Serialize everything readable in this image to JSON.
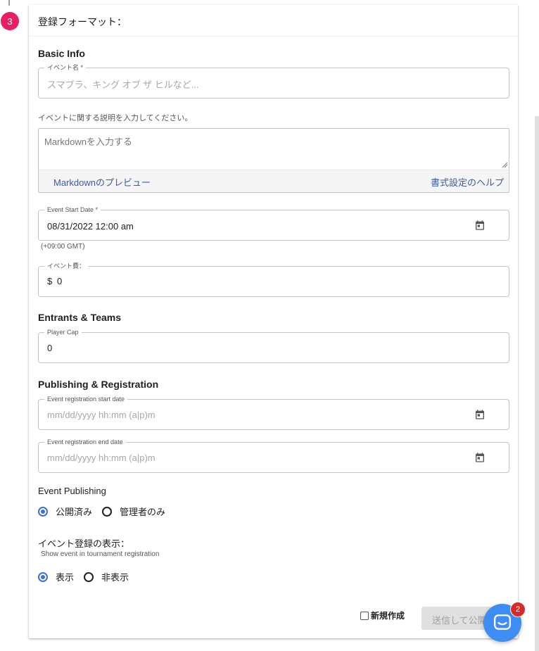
{
  "step": {
    "number": "3"
  },
  "header": {
    "title": "登録フォーマット："
  },
  "basic_info": {
    "title": "Basic Info",
    "event_name": {
      "label": "イベント名 *",
      "placeholder": "スマブラ、キング オブ ザ ヒルなど..."
    },
    "description": {
      "helper": "イベントに関する説明を入力してください。",
      "placeholder": "Markdownを入力する",
      "preview_link": "Markdownのプレビュー",
      "help_link": "書式設定のヘルプ"
    },
    "start_date": {
      "label": "Event Start Date *",
      "value": "08/31/2022 12:00 am",
      "timezone": "(+09:00 GMT)",
      "icon": "calendar-icon"
    },
    "fee": {
      "label": "イベント費：",
      "currency": "$",
      "value": "0"
    }
  },
  "entrants": {
    "title": "Entrants & Teams",
    "player_cap": {
      "label": "Player Cap",
      "value": "0"
    }
  },
  "publishing": {
    "title": "Publishing & Registration",
    "reg_start": {
      "label": "Event registration start date",
      "placeholder": "mm/dd/yyyy hh:mm (a|p)m",
      "icon": "calendar-icon"
    },
    "reg_end": {
      "label": "Event registration end date",
      "placeholder": "mm/dd/yyyy hh:mm (a|p)m",
      "icon": "calendar-icon"
    },
    "event_publishing": {
      "label": "Event Publishing",
      "options": [
        {
          "label": "公開済み",
          "selected": true
        },
        {
          "label": "管理者のみ",
          "selected": false
        }
      ]
    },
    "visibility": {
      "label": "イベント登録の表示：",
      "helper": "Show event in tournament registration",
      "options": [
        {
          "label": "表示",
          "selected": true
        },
        {
          "label": "非表示",
          "selected": false
        }
      ]
    }
  },
  "footer": {
    "create_new_label": "新規作成",
    "submit_label": "送信して公開",
    "chat_badge": "2"
  },
  "colors": {
    "accent": "#3f6fd8",
    "step_badge": "#e91e63",
    "link": "#3b5ba9",
    "chat": "#3d8df5",
    "notification": "#d62b2b"
  }
}
